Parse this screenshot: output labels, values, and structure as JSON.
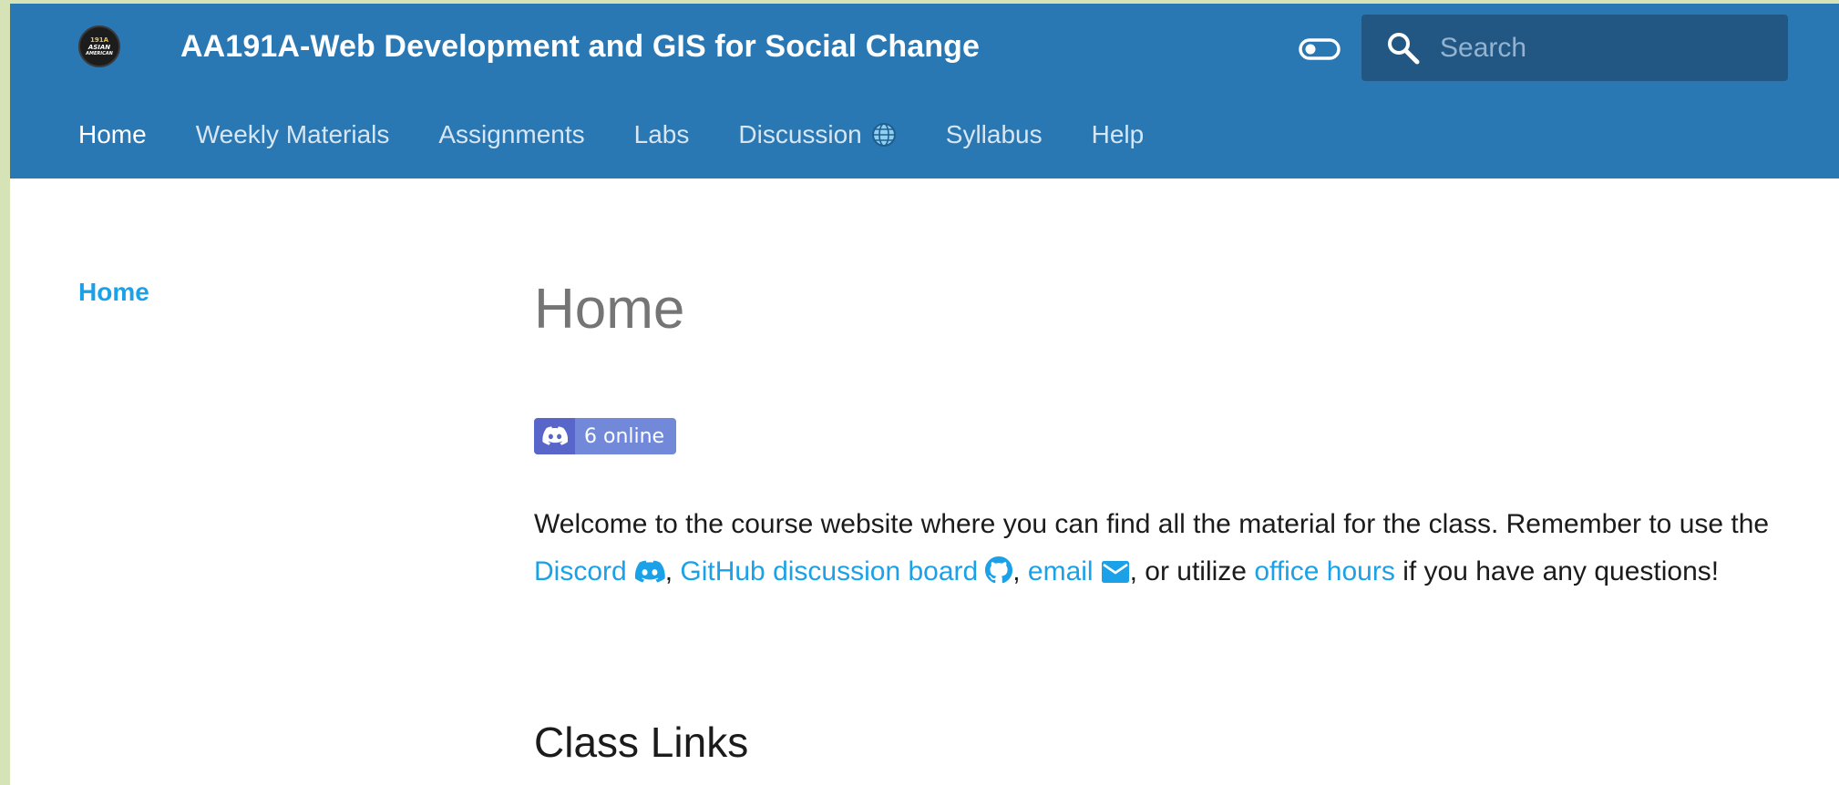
{
  "header": {
    "logo": {
      "line1": "191A",
      "line2": "ASIAN",
      "line3": "AMERICAN"
    },
    "title": "AA191A-Web Development and GIS for Social Change",
    "search_placeholder": "Search"
  },
  "nav": {
    "items": [
      {
        "label": "Home",
        "active": true
      },
      {
        "label": "Weekly Materials",
        "active": false
      },
      {
        "label": "Assignments",
        "active": false
      },
      {
        "label": "Labs",
        "active": false
      },
      {
        "label": "Discussion",
        "active": false,
        "icon": "globe-icon"
      },
      {
        "label": "Syllabus",
        "active": false
      },
      {
        "label": "Help",
        "active": false
      }
    ]
  },
  "sidebar": {
    "items": [
      {
        "label": "Home",
        "active": true
      }
    ]
  },
  "main": {
    "title": "Home",
    "discord_badge": {
      "text": "6 online",
      "icon": "discord-icon"
    },
    "intro": {
      "part1": "Welcome to the course website where you can find all the material for the class. Remember to use the ",
      "link_discord": "Discord",
      "sep1": ", ",
      "link_github": "GitHub discussion board",
      "sep2": ", ",
      "link_email": "email",
      "sep3": ", or utilize ",
      "link_office_hours": "office hours",
      "part2": " if you have any questions!"
    },
    "section_title": "Class Links"
  },
  "colors": {
    "header_bg": "#2977b3",
    "search_bg": "#225784",
    "link": "#1aa1e8",
    "discord_dark": "#5865c9",
    "discord_light": "#7289da"
  }
}
